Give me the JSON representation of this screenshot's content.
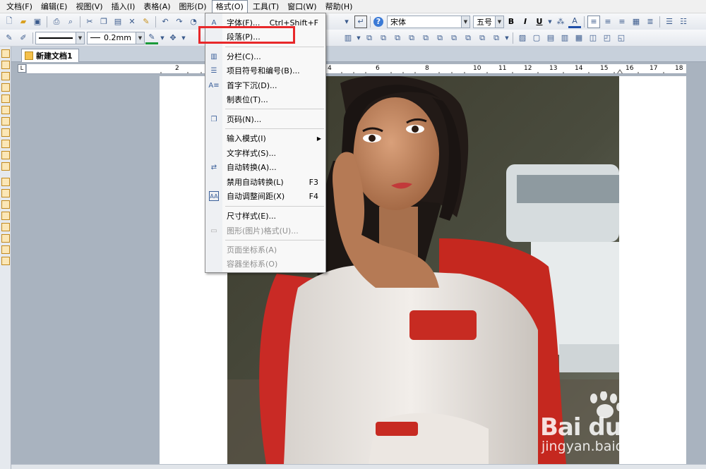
{
  "menubar": {
    "items": [
      "文档(F)",
      "编辑(E)",
      "视图(V)",
      "插入(I)",
      "表格(A)",
      "图形(D)",
      "格式(O)",
      "工具(T)",
      "窗口(W)",
      "帮助(H)"
    ]
  },
  "toolbar": {
    "line_width": "0.2mm",
    "font_name": "宋体",
    "font_size": "五号",
    "bold": "B",
    "italic": "I",
    "underline": "U"
  },
  "document": {
    "tab_title": "新建文档1"
  },
  "ruler": {
    "numbers": [
      "2",
      "4",
      "6",
      "8",
      "10",
      "11",
      "12",
      "13",
      "14",
      "15",
      "16",
      "17",
      "18"
    ]
  },
  "format_menu": {
    "items": [
      {
        "label": "字体(F)...",
        "shortcut": "Ctrl+Shift+F",
        "icon": "font-icon"
      },
      {
        "label": "段落(P)...",
        "shortcut": "",
        "icon": "paragraph-icon"
      },
      {
        "label": "分栏(C)...",
        "shortcut": "",
        "icon": "columns-icon"
      },
      {
        "label": "项目符号和编号(B)...",
        "shortcut": "",
        "icon": "bullets-icon"
      },
      {
        "label": "首字下沉(D)...",
        "shortcut": "",
        "icon": "drop-cap-icon"
      },
      {
        "label": "制表位(T)...",
        "shortcut": "",
        "icon": "tab-stop-icon"
      },
      {
        "label": "页码(N)...",
        "shortcut": "",
        "icon": "page-number-icon"
      },
      {
        "label": "输入模式(I)",
        "shortcut": "",
        "icon": "input-mode-icon"
      },
      {
        "label": "文字样式(S)...",
        "shortcut": "",
        "icon": "text-style-icon"
      },
      {
        "label": "自动转换(A)...",
        "shortcut": "",
        "icon": "auto-convert-icon"
      },
      {
        "label": "禁用自动转换(L)",
        "shortcut": "F3",
        "icon": "disable-convert-icon"
      },
      {
        "label": "自动调整间距(X)",
        "shortcut": "F4",
        "icon": "auto-spacing-icon"
      },
      {
        "label": "尺寸样式(E)...",
        "shortcut": "",
        "icon": "size-style-icon"
      },
      {
        "label": "图形(图片)格式(U)...",
        "shortcut": "",
        "icon": "picture-format-icon"
      },
      {
        "label": "页面坐标系(A)",
        "shortcut": "",
        "icon": "page-coords-icon"
      },
      {
        "label": "容器坐标系(O)",
        "shortcut": "",
        "icon": "container-coords-icon"
      }
    ]
  },
  "watermark": {
    "brand": "Bai du 经验",
    "url": "jingyan.baidu.com"
  }
}
